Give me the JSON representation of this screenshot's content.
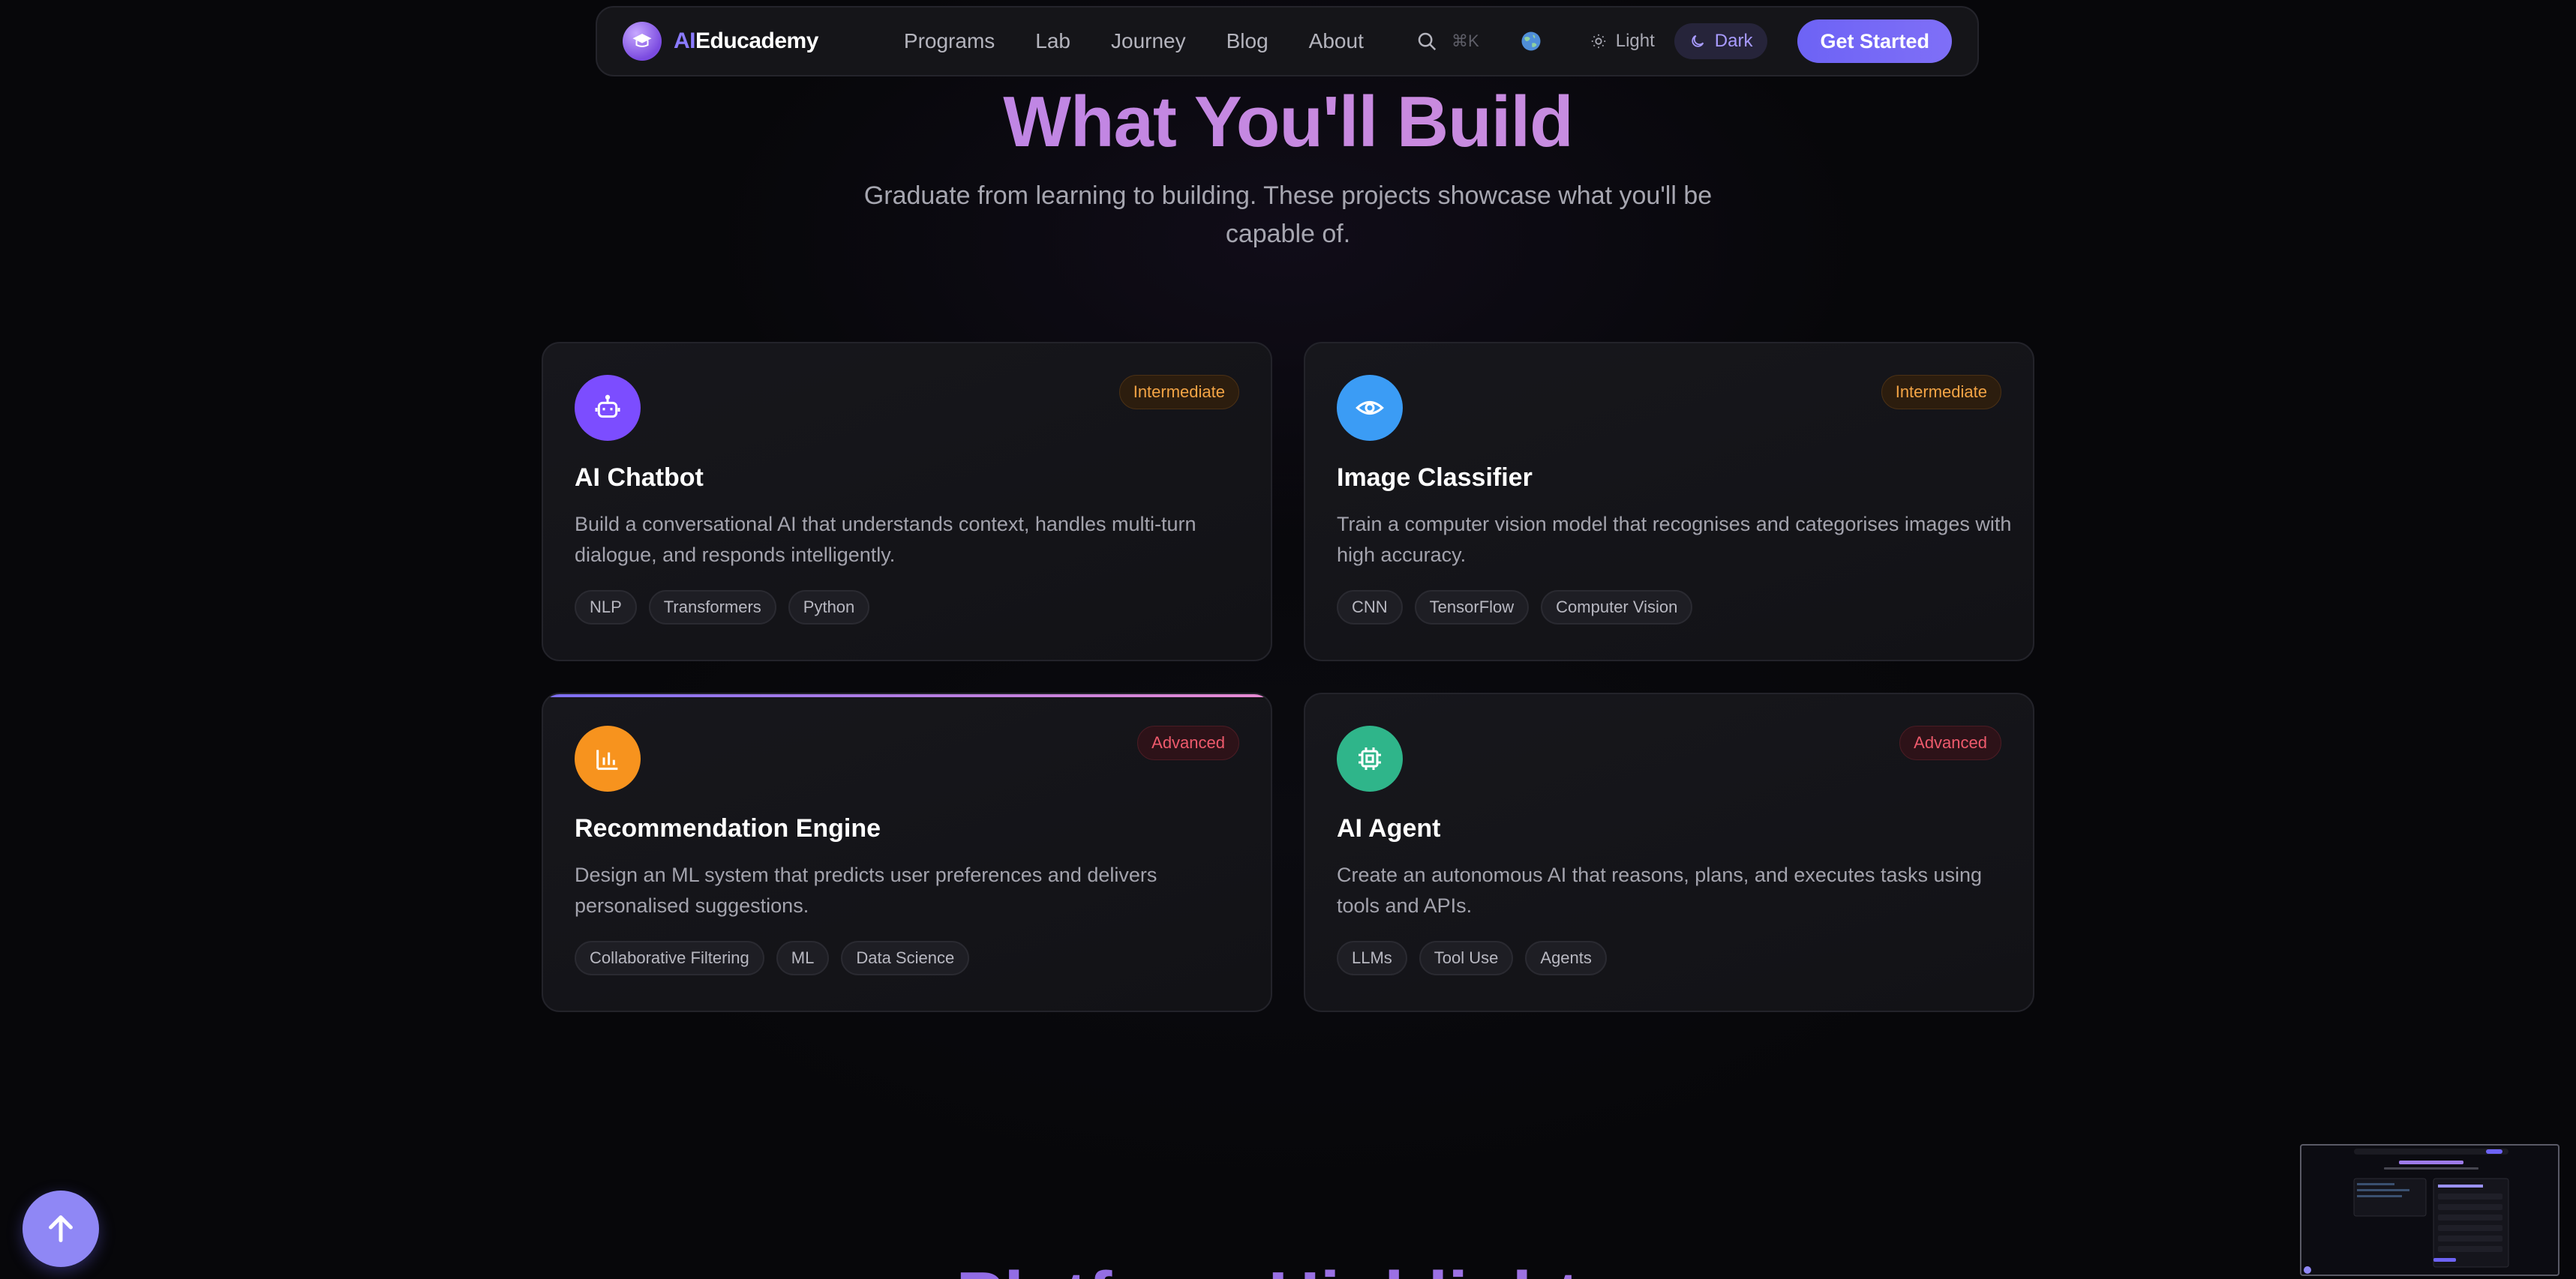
{
  "nav": {
    "brand_ai": "AI",
    "brand_rest": "Educademy",
    "links": [
      "Programs",
      "Lab",
      "Journey",
      "Blog",
      "About"
    ],
    "search_shortcut": "⌘K",
    "theme_light": "Light",
    "theme_dark": "Dark",
    "cta": "Get Started"
  },
  "section": {
    "title": "What You'll Build",
    "subtitle": "Graduate from learning to building. These projects showcase what you'll be capable of."
  },
  "cards": [
    {
      "title": "AI Chatbot",
      "level": "Intermediate",
      "description": "Build a conversational AI that understands context, handles multi-turn dialogue, and responds intelligently.",
      "tags": [
        "NLP",
        "Transformers",
        "Python"
      ],
      "icon": "robot-icon",
      "color": "#7c4dff"
    },
    {
      "title": "Image Classifier",
      "level": "Intermediate",
      "description": "Train a computer vision model that recognises and categorises images with high accuracy.",
      "tags": [
        "CNN",
        "TensorFlow",
        "Computer Vision"
      ],
      "icon": "eye-icon",
      "color": "#3b9cf5"
    },
    {
      "title": "Recommendation Engine",
      "level": "Advanced",
      "description": "Design an ML system that predicts user preferences and delivers personalised suggestions.",
      "tags": [
        "Collaborative Filtering",
        "ML",
        "Data Science"
      ],
      "icon": "bar-chart-icon",
      "color": "#f7931e"
    },
    {
      "title": "AI Agent",
      "level": "Advanced",
      "description": "Create an autonomous AI that reasons, plans, and executes tasks using tools and APIs.",
      "tags": [
        "LLMs",
        "Tool Use",
        "Agents"
      ],
      "icon": "cpu-icon",
      "color": "#2fb58a"
    }
  ],
  "next_section_title": "Platform Highlights",
  "colors": {
    "accent": "#7f6ff7",
    "intermediate": "#f3a445",
    "advanced": "#ee5a6c"
  }
}
